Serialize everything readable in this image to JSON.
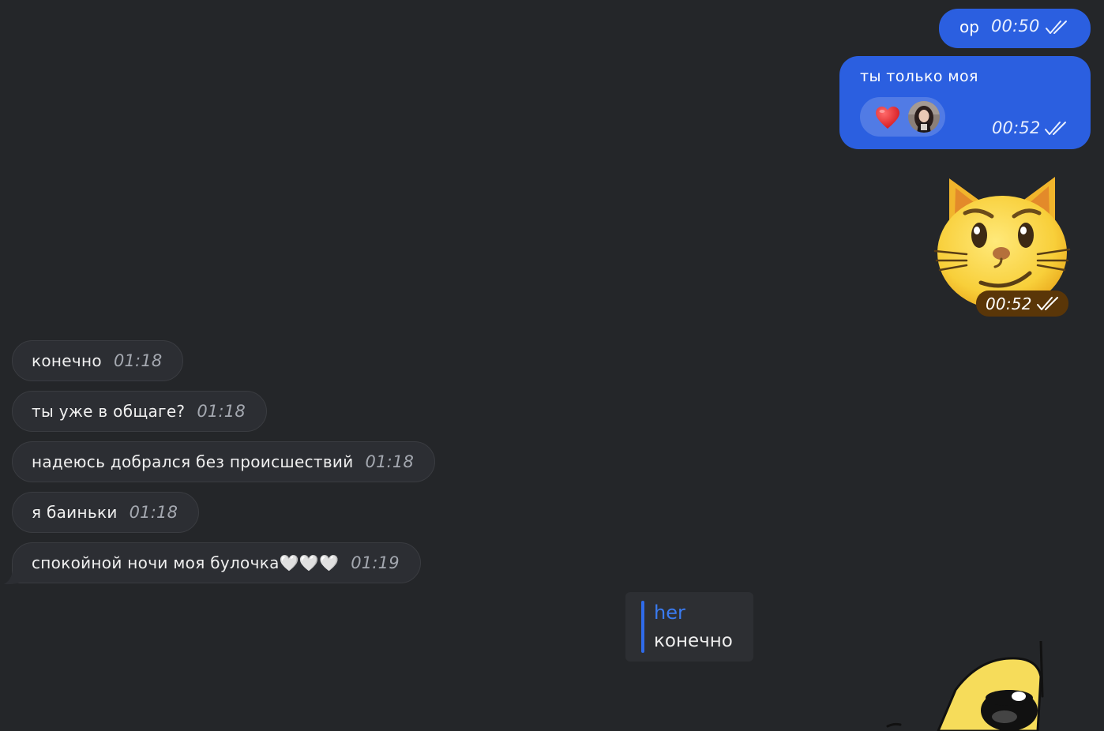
{
  "colors": {
    "background": "#242629",
    "outgoing_bubble": "#2b5fe0",
    "incoming_bubble": "#2c2e33",
    "reply_accent": "#2f6bea",
    "timestamp_incoming": "#a4a8b0"
  },
  "outgoing": [
    {
      "text": "ор",
      "time": "00:50",
      "status": "double-check-read"
    },
    {
      "text": "ты только моя",
      "time": "00:52",
      "status": "double-check-read",
      "reactions": [
        {
          "emoji": "heart",
          "avatar": "reactor-avatar"
        }
      ]
    }
  ],
  "sticker": {
    "name": "smirking-cat-sticker",
    "time": "00:52",
    "status": "double-check-read"
  },
  "incoming": [
    {
      "text": "конечно",
      "time": "01:18"
    },
    {
      "text": "ты уже в общаге?",
      "time": "01:18"
    },
    {
      "text": "надеюсь добрался без происшествий",
      "time": "01:18"
    },
    {
      "text": "я баиньки",
      "time": "01:18"
    },
    {
      "text": "спокойной ночи моя булочка🤍🤍🤍",
      "time": "01:19"
    }
  ],
  "reply_preview": {
    "author": "her",
    "text": "конечно"
  },
  "partial_sticker": {
    "name": "yellow-creature-sticker"
  }
}
